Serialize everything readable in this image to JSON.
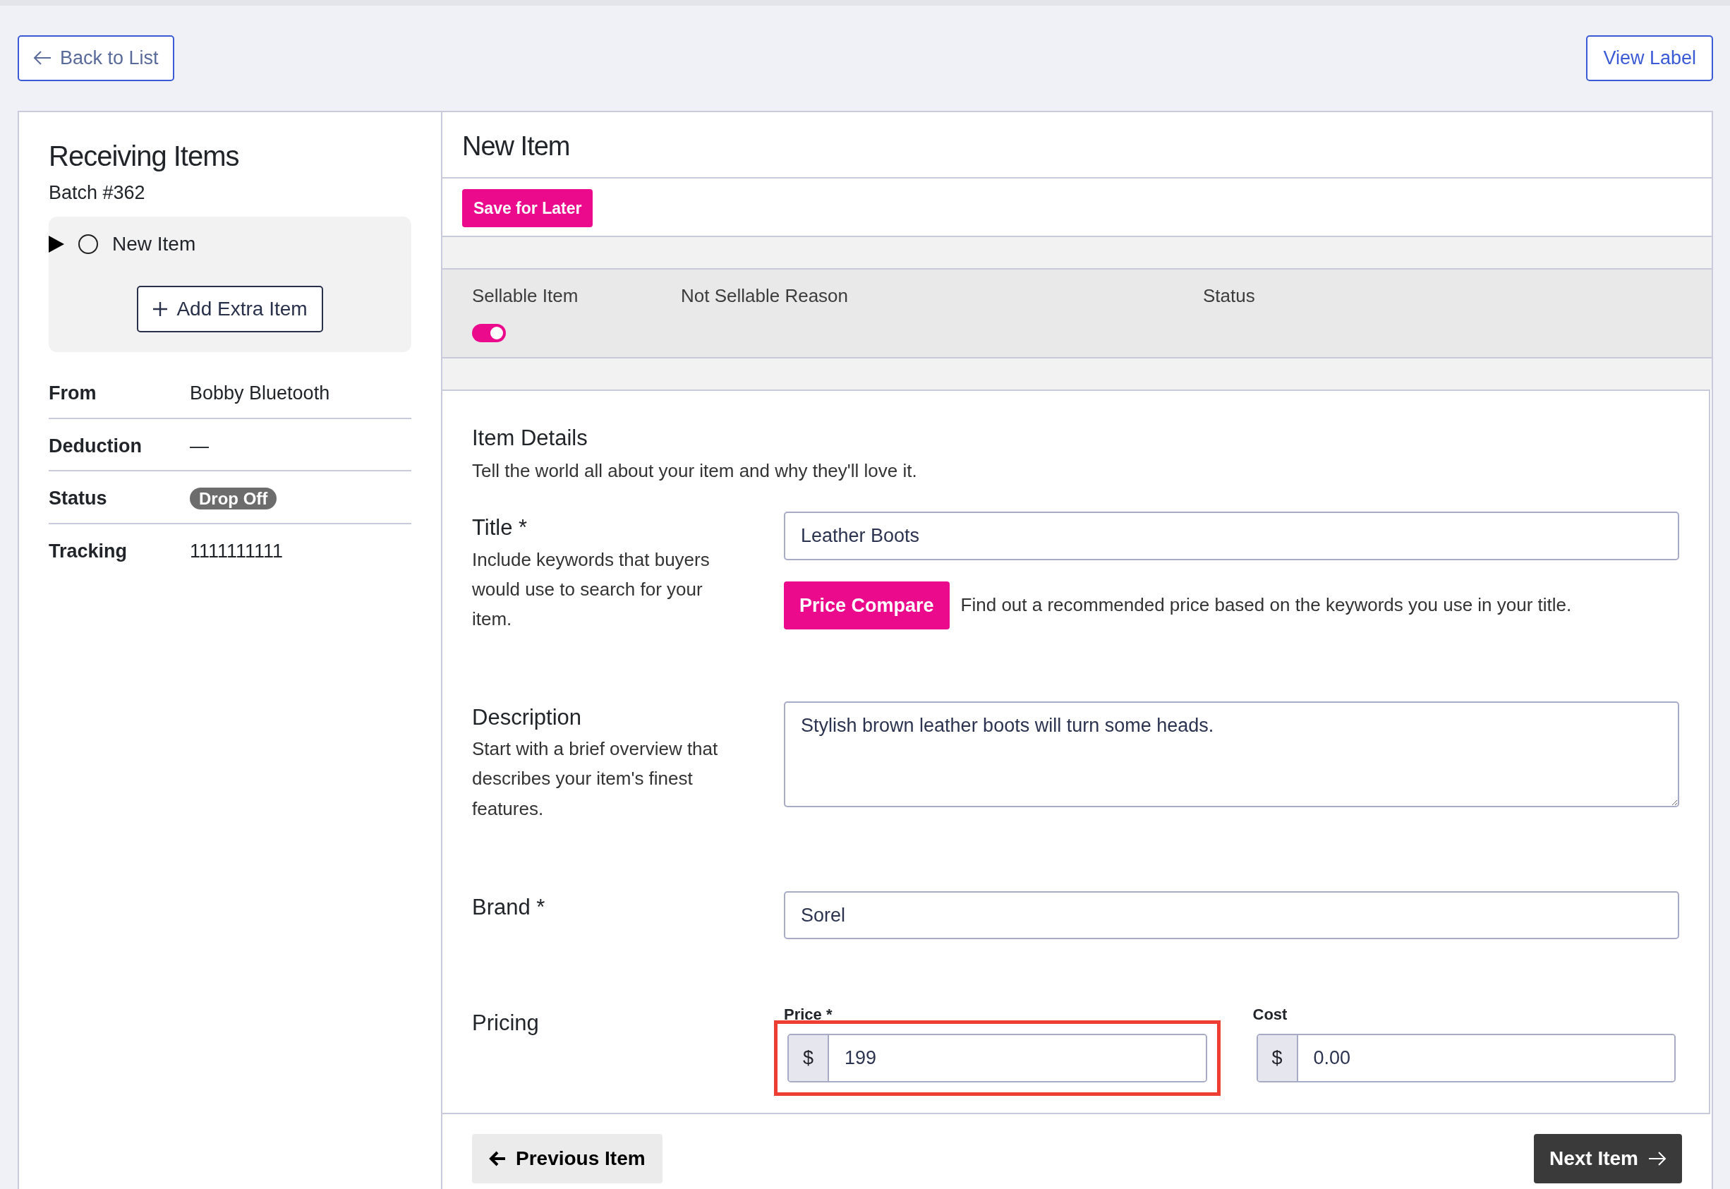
{
  "top_bar": {
    "back_button": "Back to List",
    "view_label_button": "View Label"
  },
  "sidebar": {
    "title": "Receiving Items",
    "batch": "Batch #362",
    "items": [
      {
        "label": "New Item",
        "expanded": false,
        "checked": false
      }
    ],
    "add_button": "Add Extra Item",
    "details": [
      {
        "label": "From",
        "value": "Bobby Bluetooth",
        "kind": "text"
      },
      {
        "label": "Deduction",
        "value": "—",
        "kind": "text"
      },
      {
        "label": "Status",
        "value": "Drop Off",
        "kind": "badge"
      },
      {
        "label": "Tracking",
        "value": "1111111111",
        "kind": "text"
      }
    ]
  },
  "main": {
    "title": "New Item",
    "save_button": "Save for Later",
    "status_strip": {
      "columns": [
        "Sellable Item",
        "Not Sellable Reason",
        "Status"
      ],
      "sellable_on": true
    },
    "section": {
      "title": "Item Details",
      "subtitle": "Tell the world all about your item and why they'll love it."
    },
    "fields": [
      {
        "kind": "input",
        "label": "Title *",
        "help": "Include keywords that buyers would use to search for your item.",
        "value": "Leather Boots",
        "button": "Price Compare",
        "button_note": "Find out a recommended price based on the keywords you use in your title."
      },
      {
        "kind": "textarea",
        "label": "Description",
        "help": "Start with a brief overview that describes your item's finest features.",
        "value": "Stylish brown leather boots will turn some heads."
      },
      {
        "kind": "input",
        "label": "Brand *",
        "value": "Sorel"
      },
      {
        "kind": "pricing",
        "label": "Pricing",
        "prices": [
          {
            "label": "Price *",
            "prefix": "$",
            "value": "199",
            "highlighted": true
          },
          {
            "label": "Cost",
            "prefix": "$",
            "value": "0.00",
            "highlighted": false
          }
        ]
      }
    ],
    "previous_button": "Previous Item",
    "next_button": "Next Item"
  }
}
